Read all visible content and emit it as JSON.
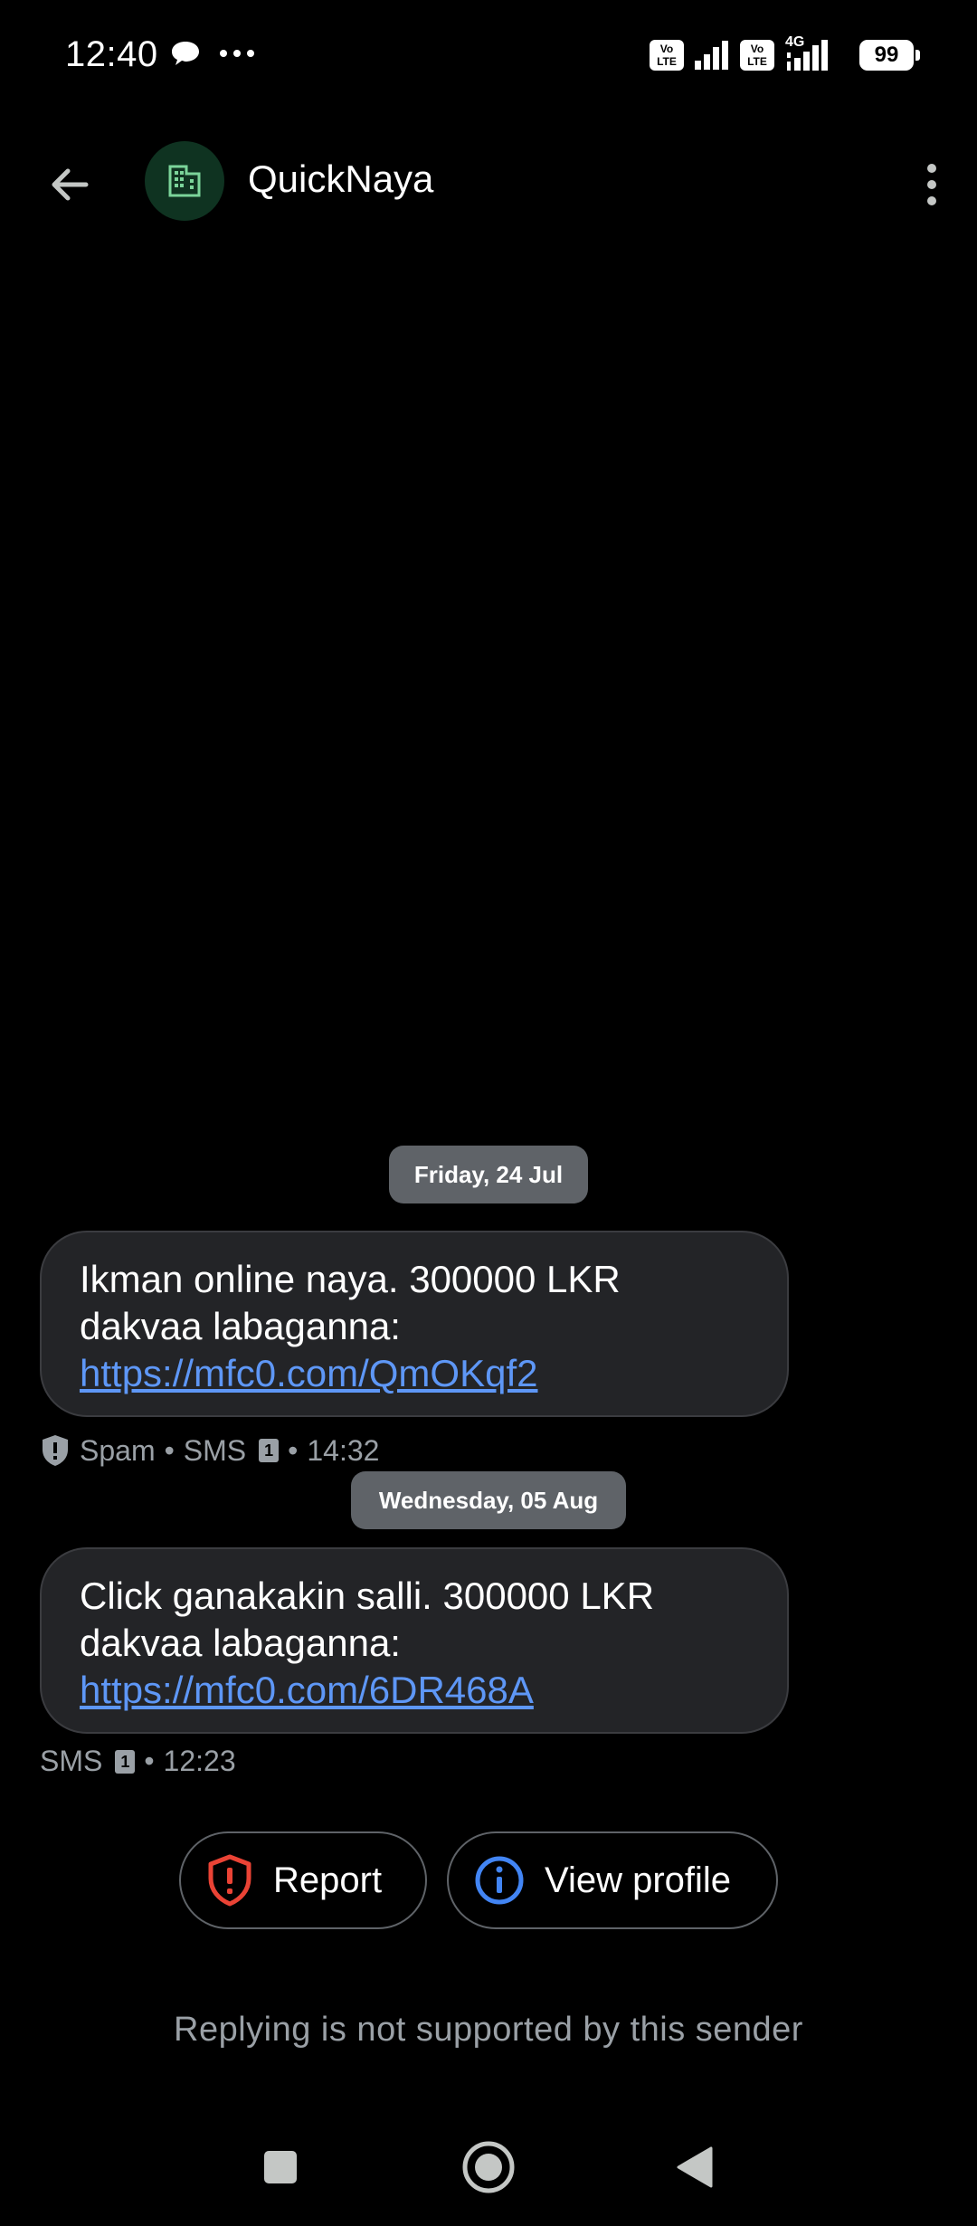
{
  "status_bar": {
    "time": "12:40",
    "volte_label": "Vo LTE",
    "network_label": "4G",
    "battery_level": "99"
  },
  "app_bar": {
    "sender_name": "QuickNaya",
    "avatar_icon": "building-icon",
    "avatar_color": "#0f3321"
  },
  "conversation": {
    "date_chips": [
      "Friday, 24 Jul",
      "Wednesday, 05 Aug"
    ],
    "messages": [
      {
        "text": "Ikman online naya. 300000 LKR dakvaa labaganna:",
        "link": "https://mfc0.com/QmOKqf2",
        "spam_label": "Spam",
        "type_label": "SMS",
        "sim": "1",
        "time": "14:32"
      },
      {
        "text": "Click ganakakin salli. 300000 LKR dakvaa labaganna:",
        "link": "https://mfc0.com/6DR468A",
        "type_label": "SMS",
        "sim": "1",
        "time": "12:23"
      }
    ],
    "separator": "•"
  },
  "actions": {
    "report_label": "Report",
    "view_profile_label": "View profile"
  },
  "reply_note": "Replying is not supported by this sender",
  "colors": {
    "link": "#5e97f6",
    "report_icon": "#ea4335",
    "info_icon": "#4285f4"
  }
}
